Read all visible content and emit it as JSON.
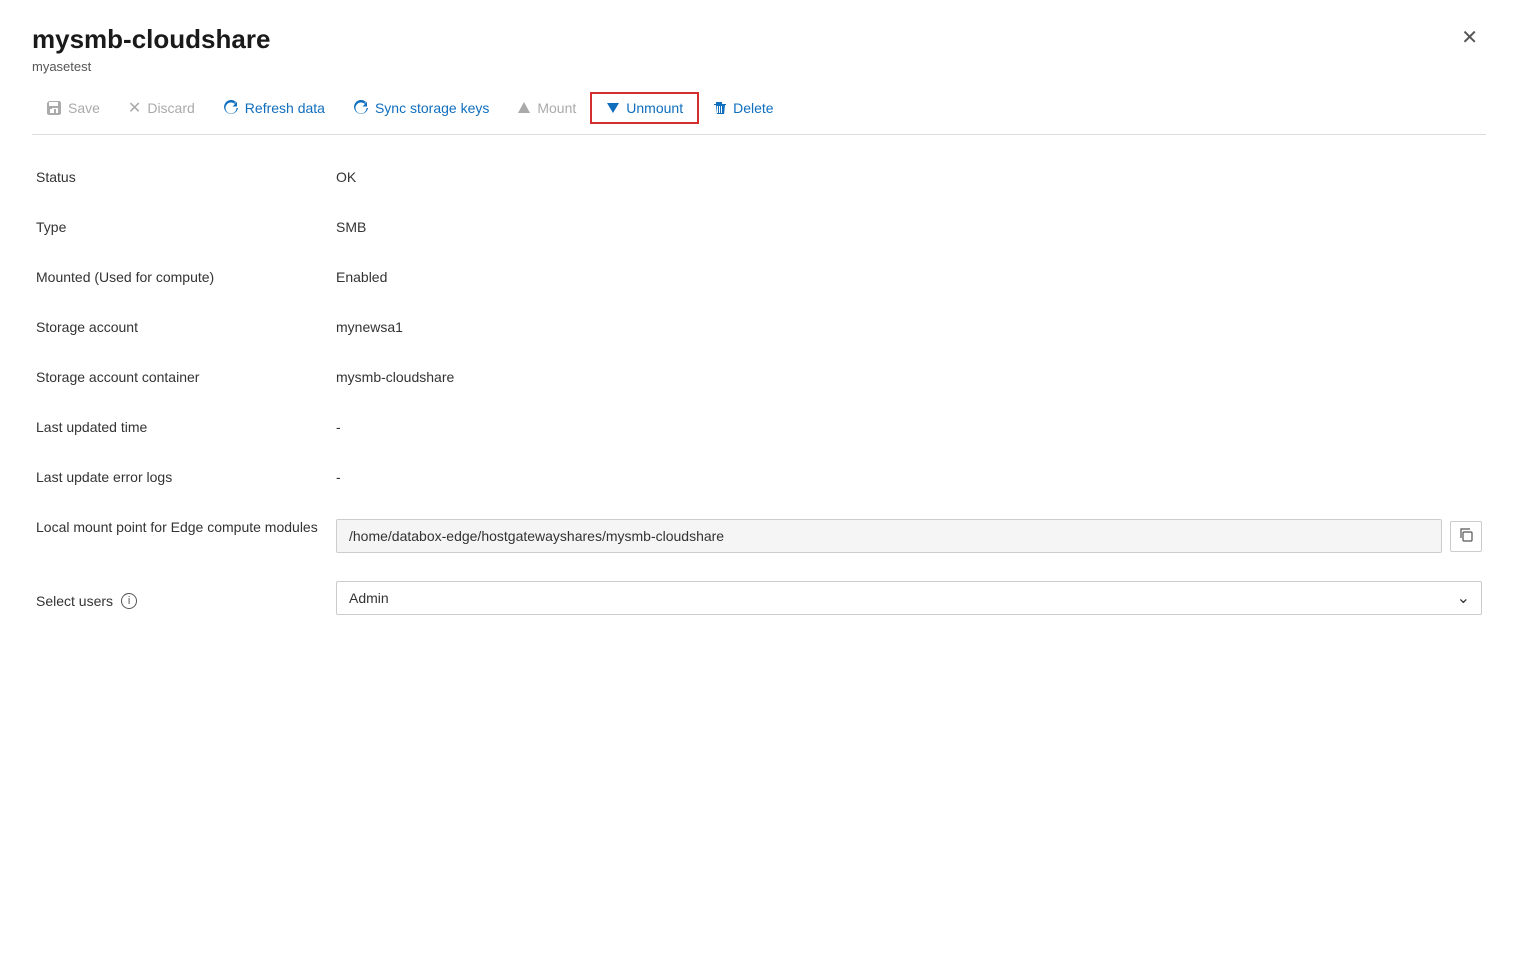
{
  "panel": {
    "title": "mysmb-cloudshare",
    "subtitle": "myasetest"
  },
  "toolbar": {
    "save_label": "Save",
    "discard_label": "Discard",
    "refresh_label": "Refresh data",
    "sync_label": "Sync storage keys",
    "mount_label": "Mount",
    "unmount_label": "Unmount",
    "delete_label": "Delete"
  },
  "fields": {
    "status_label": "Status",
    "status_value": "OK",
    "type_label": "Type",
    "type_value": "SMB",
    "mounted_label": "Mounted (Used for compute)",
    "mounted_value": "Enabled",
    "storage_account_label": "Storage account",
    "storage_account_value": "mynewsa1",
    "storage_container_label": "Storage account container",
    "storage_container_value": "mysmb-cloudshare",
    "last_updated_label": "Last updated time",
    "last_updated_value": "-",
    "last_error_label": "Last update error logs",
    "last_error_value": "-",
    "mount_point_label": "Local mount point for Edge compute modules",
    "mount_point_value": "/home/databox-edge/hostgatewayshares/mysmb-cloudshare",
    "select_users_label": "Select users",
    "select_users_value": "Admin"
  },
  "icons": {
    "save": "🖫",
    "discard": "✕",
    "refresh": "↺",
    "sync": "↺",
    "mount": "△",
    "unmount": "▽",
    "delete": "🗑",
    "copy": "❐",
    "chevron_down": "⌄",
    "info": "i",
    "close": "✕"
  }
}
